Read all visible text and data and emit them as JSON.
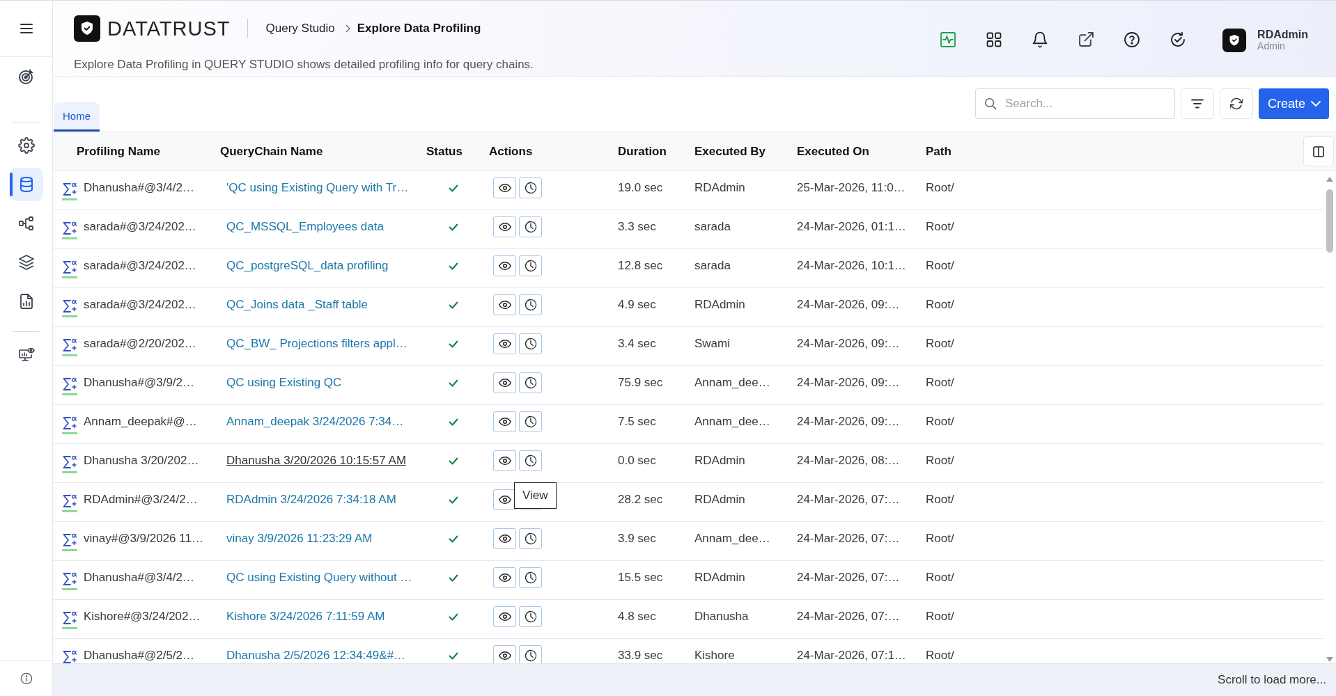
{
  "sidebar": {
    "groups": [
      {
        "items": [
          {
            "kind": "target",
            "selected": false
          }
        ]
      },
      {
        "items": [
          {
            "kind": "settings",
            "selected": false
          },
          {
            "kind": "database",
            "selected": true
          },
          {
            "kind": "nodes",
            "selected": false
          },
          {
            "kind": "layers",
            "selected": false
          },
          {
            "kind": "report",
            "selected": false
          }
        ]
      },
      {
        "items": [
          {
            "kind": "monitor",
            "selected": false
          }
        ]
      }
    ]
  },
  "header": {
    "logo": "DATATRUST",
    "breadcrumb": [
      "Query Studio",
      "Explore Data Profiling"
    ],
    "description": "Explore Data Profiling in QUERY STUDIO shows detailed profiling info for query chains.",
    "user": {
      "name": "RDAdmin",
      "role": "Admin"
    }
  },
  "tabs": [
    {
      "label": "Home",
      "selected": true
    }
  ],
  "toolbar": {
    "search": {
      "placeholder": "Search..."
    },
    "create_button": "Create"
  },
  "table": {
    "columns": [
      "Profiling Name",
      "QueryChain Name",
      "Status",
      "Actions",
      "Duration",
      "Executed By",
      "Executed On",
      "Path"
    ],
    "rows": [
      {
        "profiling_name": "Dhanusha#@3/4/2…",
        "querychain_name": "'QC using Existing Query with Tr…",
        "succeeded": true,
        "hovered": false,
        "duration": "19.0 sec",
        "executed_by": "RDAdmin",
        "executed_on": "25-Mar-2026, 11:0…",
        "path": "Root/"
      },
      {
        "profiling_name": "sarada#@3/24/202…",
        "querychain_name": "QC_MSSQL_Employees data",
        "succeeded": true,
        "hovered": false,
        "duration": "3.3 sec",
        "executed_by": "sarada",
        "executed_on": "24-Mar-2026, 01:1…",
        "path": "Root/"
      },
      {
        "profiling_name": "sarada#@3/24/202…",
        "querychain_name": "QC_postgreSQL_data profiling",
        "succeeded": true,
        "hovered": false,
        "duration": "12.8 sec",
        "executed_by": "sarada",
        "executed_on": "24-Mar-2026, 10:1…",
        "path": "Root/"
      },
      {
        "profiling_name": "sarada#@3/24/202…",
        "querychain_name": "QC_Joins data _Staff table",
        "succeeded": true,
        "hovered": false,
        "duration": "4.9 sec",
        "executed_by": "RDAdmin",
        "executed_on": "24-Mar-2026, 09:…",
        "path": "Root/"
      },
      {
        "profiling_name": "sarada#@2/20/202…",
        "querychain_name": "QC_BW_ Projections filters appl…",
        "succeeded": true,
        "hovered": false,
        "duration": "3.4 sec",
        "executed_by": "Swami",
        "executed_on": "24-Mar-2026, 09:…",
        "path": "Root/"
      },
      {
        "profiling_name": "Dhanusha#@3/9/2…",
        "querychain_name": "QC using Existing QC",
        "succeeded": true,
        "hovered": false,
        "duration": "75.9 sec",
        "executed_by": "Annam_dee…",
        "executed_on": "24-Mar-2026, 09:…",
        "path": "Root/"
      },
      {
        "profiling_name": "Annam_deepak#@…",
        "querychain_name": "Annam_deepak 3/24/2026 7:34…",
        "succeeded": true,
        "hovered": false,
        "duration": "7.5 sec",
        "executed_by": "Annam_dee…",
        "executed_on": "24-Mar-2026, 09:…",
        "path": "Root/"
      },
      {
        "profiling_name": "Dhanusha 3/20/202…",
        "querychain_name": "Dhanusha 3/20/2026 10:15:57 AM",
        "succeeded": true,
        "hovered": true,
        "tooltip": "View",
        "duration": "0.0 sec",
        "executed_by": "RDAdmin",
        "executed_on": "24-Mar-2026, 08:…",
        "path": "Root/"
      },
      {
        "profiling_name": "RDAdmin#@3/24/2…",
        "querychain_name": "RDAdmin 3/24/2026 7:34:18 AM",
        "succeeded": true,
        "hovered": false,
        "duration": "28.2 sec",
        "executed_by": "RDAdmin",
        "executed_on": "24-Mar-2026, 07:…",
        "path": "Root/"
      },
      {
        "profiling_name": "vinay#@3/9/2026 11…",
        "querychain_name": "vinay 3/9/2026 11:23:29 AM",
        "succeeded": true,
        "hovered": false,
        "duration": "3.9 sec",
        "executed_by": "Annam_dee…",
        "executed_on": "24-Mar-2026, 07:…",
        "path": "Root/"
      },
      {
        "profiling_name": "Dhanusha#@3/4/2…",
        "querychain_name": "QC using Existing Query without …",
        "succeeded": true,
        "hovered": false,
        "duration": "15.5 sec",
        "executed_by": "RDAdmin",
        "executed_on": "24-Mar-2026, 07:…",
        "path": "Root/"
      },
      {
        "profiling_name": "Kishore#@3/24/202…",
        "querychain_name": "Kishore 3/24/2026 7:11:59 AM",
        "succeeded": true,
        "hovered": false,
        "duration": "4.8 sec",
        "executed_by": "Dhanusha",
        "executed_on": "24-Mar-2026, 07:…",
        "path": "Root/"
      },
      {
        "profiling_name": "Dhanusha#@2/5/2…",
        "querychain_name": "Dhanusha 2/5/2026 12:34:49&#…",
        "succeeded": true,
        "hovered": false,
        "duration": "33.9 sec",
        "executed_by": "Kishore",
        "executed_on": "24-Mar-2026, 07:1…",
        "path": "Root/"
      }
    ]
  },
  "footer": {
    "text": "Scroll to load more..."
  }
}
